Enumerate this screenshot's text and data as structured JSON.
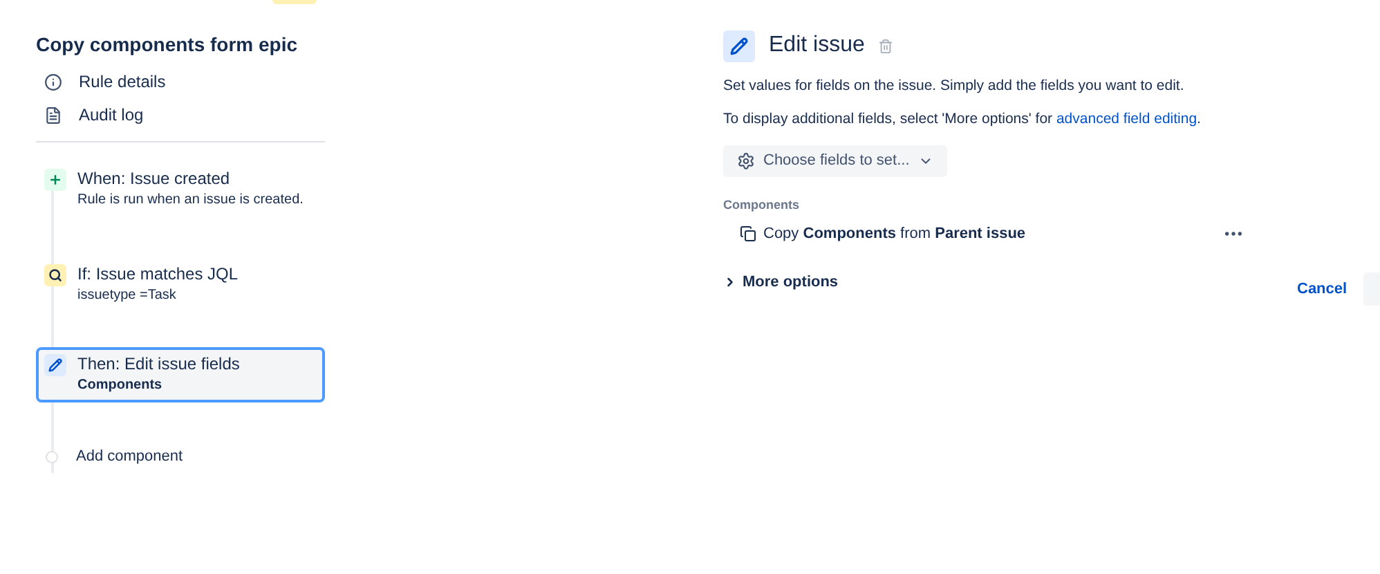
{
  "rule": {
    "name": "Copy components form epic",
    "links": [
      {
        "kind": "info",
        "label": "Rule details"
      },
      {
        "kind": "log",
        "label": "Audit log"
      }
    ]
  },
  "steps": [
    {
      "kind": "trigger",
      "title": "When: Issue created",
      "subtitle": "Rule is run when an issue is created.",
      "selected": false
    },
    {
      "kind": "condition",
      "title": "If: Issue matches JQL",
      "subtitle": "issuetype =Task",
      "selected": false
    },
    {
      "kind": "action",
      "title": "Then: Edit issue fields",
      "subtitle": "Components",
      "selected": true
    }
  ],
  "add_component": "Add component",
  "editor": {
    "title": "Edit issue",
    "description": "Set values for fields on the issue. Simply add the fields you want to edit.",
    "hint": "To display additional fields, select 'More options' for ",
    "hint_link": "advanced field editing",
    "hint_end": ".",
    "choose_button": "Choose fields to set...",
    "field_label": "Components",
    "field_value": "Copy **Components** from **Parent issue**",
    "more_options": "More options",
    "cancel": "Cancel"
  }
}
